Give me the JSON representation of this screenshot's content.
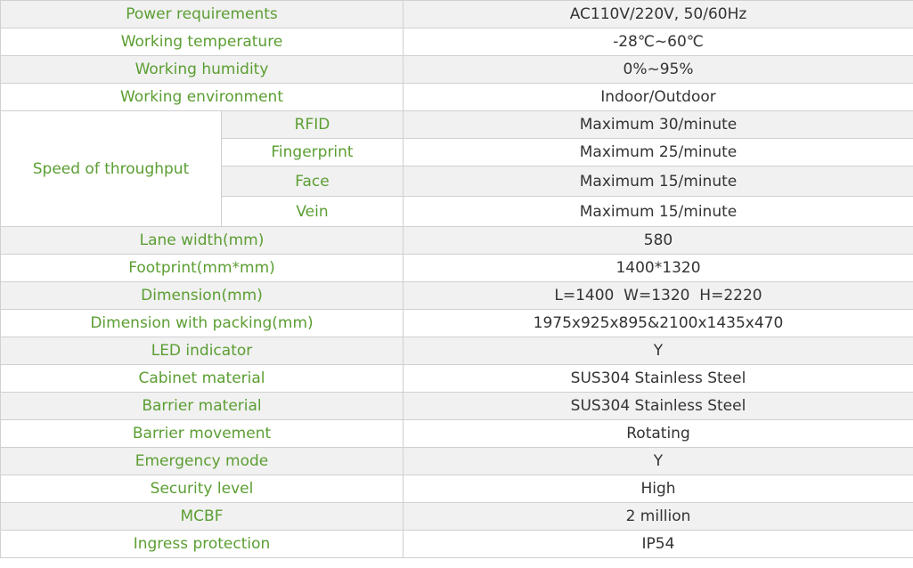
{
  "rows": [
    {
      "label": "Power requirements",
      "value": "AC110V/220V, 50/60Hz"
    },
    {
      "label": "Working temperature",
      "value": "-28℃~60℃"
    },
    {
      "label": "Working humidity",
      "value": "0%~95%"
    },
    {
      "label": "Working environment",
      "value": "Indoor/Outdoor"
    },
    {
      "label": "Speed of throughput",
      "subs": [
        {
          "label": "RFID",
          "value": "Maximum 30/minute"
        },
        {
          "label": "Fingerprint",
          "value": "Maximum 25/minute"
        },
        {
          "label": "Face",
          "value": "Maximum 15/minute"
        },
        {
          "label": "Vein",
          "value": "Maximum 15/minute"
        }
      ]
    },
    {
      "label": "Lane width(mm)",
      "value": "580"
    },
    {
      "label": "Footprint(mm*mm)",
      "value": "1400*1320"
    },
    {
      "label": "Dimension(mm)",
      "value": "L=1400  W=1320  H=2220"
    },
    {
      "label": "Dimension with packing(mm)",
      "value": "1975x925x895&2100x1435x470"
    },
    {
      "label": "LED indicator",
      "value": "Y"
    },
    {
      "label": "Cabinet material",
      "value": "SUS304 Stainless Steel"
    },
    {
      "label": "Barrier material",
      "value": "SUS304 Stainless Steel"
    },
    {
      "label": "Barrier movement",
      "value": "Rotating"
    },
    {
      "label": "Emergency mode",
      "value": "Y"
    },
    {
      "label": "Security level",
      "value": "High"
    },
    {
      "label": "MCBF",
      "value": "2 million"
    },
    {
      "label": "Ingress protection",
      "value": "IP54"
    }
  ]
}
